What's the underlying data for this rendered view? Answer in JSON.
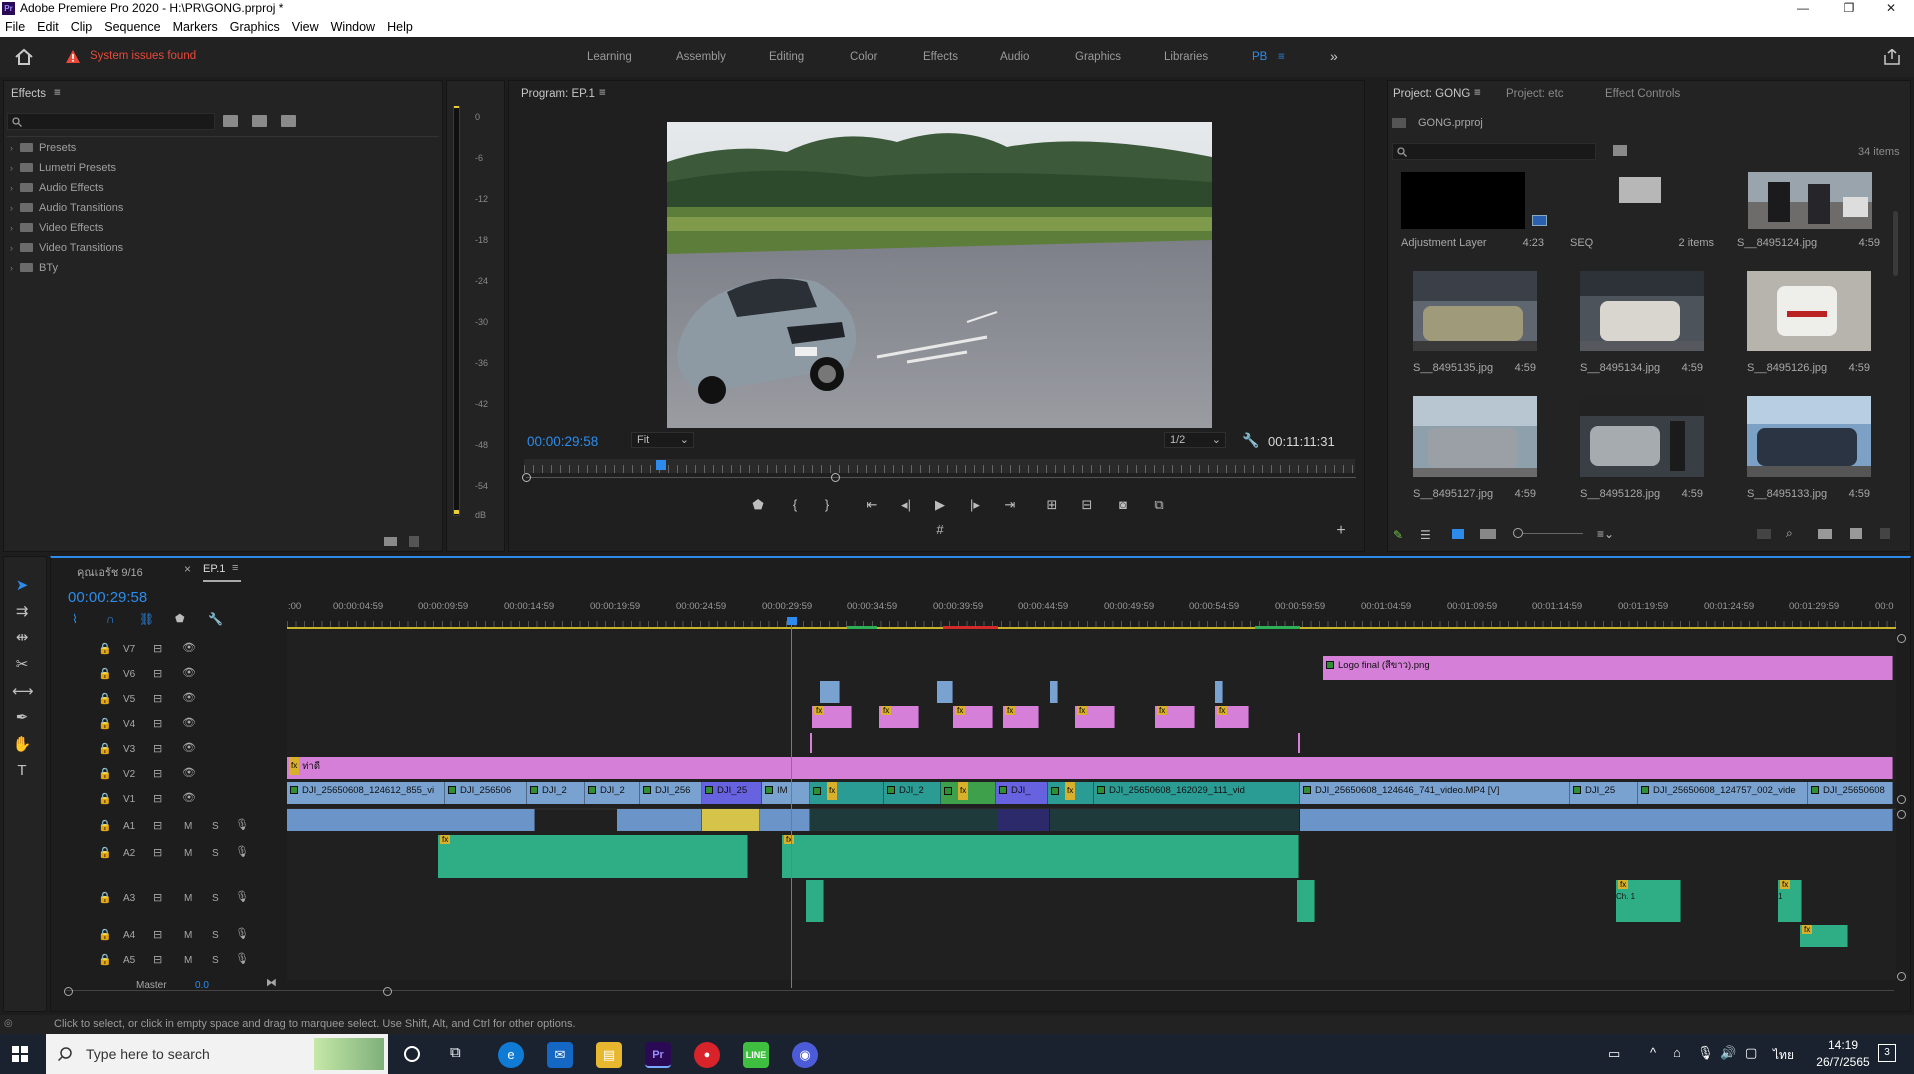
{
  "window": {
    "title": "Adobe Premiere Pro 2020 - H:\\PR\\GONG.prproj *",
    "app_badge": "Pr",
    "minimize": "—",
    "maximize": "❐",
    "close": "✕"
  },
  "menu": [
    "File",
    "Edit",
    "Clip",
    "Sequence",
    "Markers",
    "Graphics",
    "View",
    "Window",
    "Help"
  ],
  "header": {
    "alert": "System issues found",
    "workspaces": [
      "Learning",
      "Assembly",
      "Editing",
      "Color",
      "Effects",
      "Audio",
      "Graphics",
      "Libraries",
      "PB"
    ],
    "active_workspace": "PB",
    "overflow": "»"
  },
  "effects_panel": {
    "tab": "Effects",
    "tree": [
      "Presets",
      "Lumetri Presets",
      "Audio Effects",
      "Audio Transitions",
      "Video Effects",
      "Video Transitions",
      "BTy"
    ]
  },
  "meter": {
    "labels": [
      "0",
      "-6",
      "-12",
      "-18",
      "-24",
      "-30",
      "-36",
      "-42",
      "-48",
      "-54",
      "dB"
    ]
  },
  "program": {
    "tab": "Program: EP.1",
    "timecode": "00:00:29:58",
    "fit": "Fit",
    "resolution": "1/2",
    "duration": "00:11:11:31",
    "playhead_fraction": 0.045
  },
  "project": {
    "tabs": [
      "Project: GONG",
      "Project: etc",
      "Effect Controls"
    ],
    "file": "GONG.prproj",
    "items_count": "34 items",
    "items": [
      {
        "name": "Adjustment Layer",
        "dur": "4:23"
      },
      {
        "name": "SEQ",
        "dur": "2 items"
      },
      {
        "name": "S__8495124.jpg",
        "dur": "4:59"
      },
      {
        "name": "S__8495135.jpg",
        "dur": "4:59"
      },
      {
        "name": "S__8495134.jpg",
        "dur": "4:59"
      },
      {
        "name": "S__8495126.jpg",
        "dur": "4:59"
      },
      {
        "name": "S__8495127.jpg",
        "dur": "4:59"
      },
      {
        "name": "S__8495128.jpg",
        "dur": "4:59"
      },
      {
        "name": "S__8495133.jpg",
        "dur": "4:59"
      }
    ]
  },
  "timeline": {
    "tabs": [
      "คุณเอรัช 9/16",
      "EP.1"
    ],
    "close": "×",
    "timecode": "00:00:29:58",
    "ruler": [
      ":00",
      "00:00:04:59",
      "00:00:09:59",
      "00:00:14:59",
      "00:00:19:59",
      "00:00:24:59",
      "00:00:29:59",
      "00:00:34:59",
      "00:00:39:59",
      "00:00:44:59",
      "00:00:49:59",
      "00:00:54:59",
      "00:00:59:59",
      "00:01:04:59",
      "00:01:09:59",
      "00:01:14:59",
      "00:01:19:59",
      "00:01:24:59",
      "00:01:29:59",
      "00:0"
    ],
    "video_tracks": [
      "V7",
      "V6",
      "V5",
      "V4",
      "V3",
      "V2",
      "V1"
    ],
    "audio_tracks": [
      "A1",
      "A2",
      "A3",
      "A4",
      "A5"
    ],
    "master": "Master",
    "master_val": "0.0",
    "track_m": "M",
    "track_s": "S",
    "clips": {
      "v6": "Logo final (สีขาว).png",
      "v2": "ท่าดี",
      "v1": [
        "DJI_25650608_124612_855_vi",
        "DJI_256506",
        "DJI_2",
        "DJI_2",
        "DJI_256",
        "DJI_25",
        "IM",
        "DJI_2",
        "DJI_",
        "DJI_25650608_162029_111_vid",
        "DJI_25650608_124646_741_video.MP4 [V]",
        "DJI_25",
        "DJI_25650608_124757_002_vide",
        "DJI_25650608"
      ],
      "a3_label_1": "Ch. 1",
      "a3_label_2": "1"
    }
  },
  "status_text": "Click to select, or click in empty space and drag to marquee select. Use Shift, Alt, and Ctrl for other options.",
  "taskbar": {
    "search_placeholder": "Type here to search",
    "clock_time": "14:19",
    "clock_date": "26/7/2565",
    "lang": "ไทย",
    "notif": "3"
  },
  "colors": {
    "accent": "#2d8ceb",
    "alert": "#e8493a",
    "clip_pink": "#d57fd8",
    "clip_blue": "#7aa2d1",
    "audio_green": "#2fae86"
  }
}
